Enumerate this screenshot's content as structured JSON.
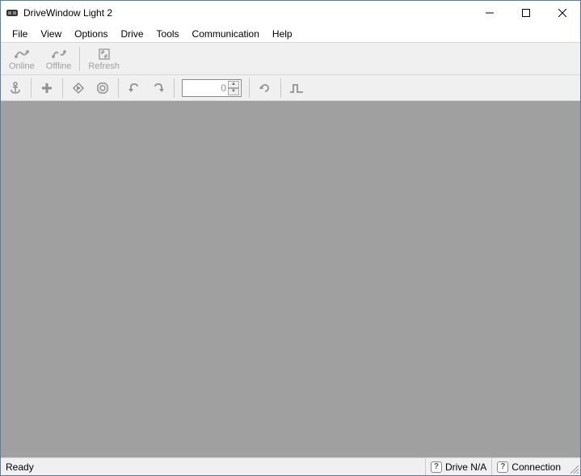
{
  "window": {
    "title": "DriveWindow Light 2"
  },
  "menu": {
    "file": "File",
    "view": "View",
    "options": "Options",
    "drive": "Drive",
    "tools": "Tools",
    "communication": "Communication",
    "help": "Help"
  },
  "toolbar1": {
    "online": "Online",
    "offline": "Offline",
    "refresh": "Refresh"
  },
  "toolbar2": {
    "numvalue": "0"
  },
  "status": {
    "ready": "Ready",
    "drive": "Drive N/A",
    "connection": "Connection"
  }
}
